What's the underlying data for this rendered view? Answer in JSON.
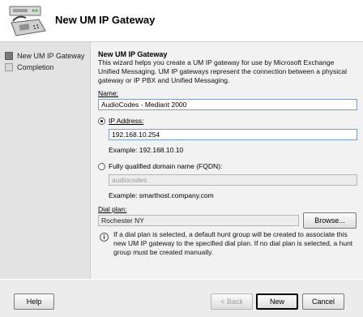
{
  "window": {
    "title": "New UM IP Gateway"
  },
  "nav": {
    "items": [
      {
        "label": "New UM IP Gateway",
        "active": true
      },
      {
        "label": "Completion",
        "active": false
      }
    ]
  },
  "content": {
    "section_title": "New UM IP Gateway",
    "description": "This wizard helps you create a UM IP gateway for use by Microsoft Exchange Unified Messaging. UM IP gateways represent the connection between a physical gateway or IP PBX and Unified Messaging.",
    "name_label": "Name:",
    "name_value": "AudioCodes - Mediant 2000",
    "ip_radio_label": "IP Address:",
    "ip_value": "192.168.10.254",
    "ip_example": "Example: 192.168.10.10",
    "fqdn_radio_label": "Fully qualified domain name (FQDN):",
    "fqdn_value": "audiocodes",
    "fqdn_example": "Example: smarthost.company.com",
    "dial_plan_label": "Dial plan:",
    "dial_plan_value": "Rochester NY",
    "browse_label": "Browse...",
    "info_text": "If a dial plan is selected, a default hunt group will be created to associate this new UM IP gateway to the specified dial plan. If no dial plan is selected, a hunt group must be created manually."
  },
  "footer": {
    "help_label": "Help",
    "back_label": "< Back",
    "new_label": "New",
    "cancel_label": "Cancel"
  }
}
